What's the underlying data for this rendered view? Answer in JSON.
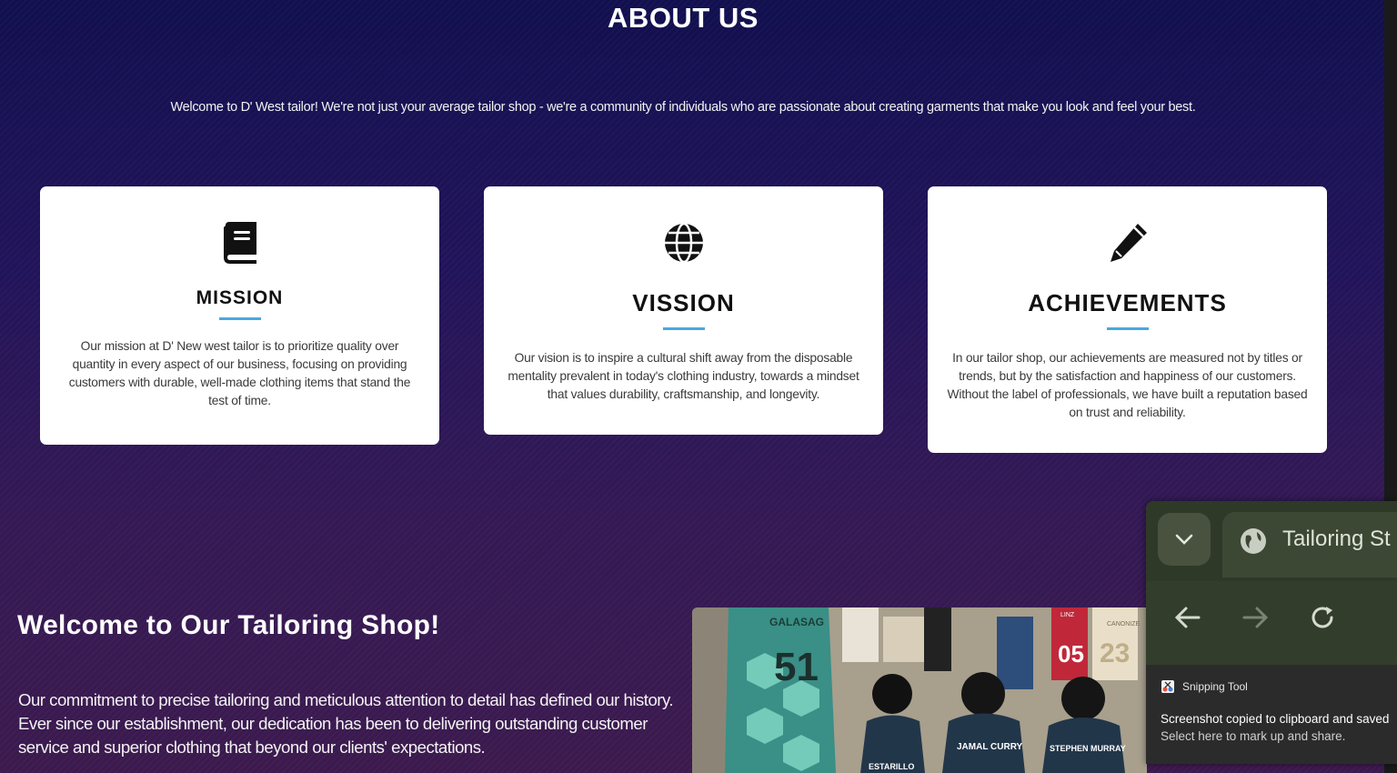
{
  "about": {
    "title": "ABOUT US",
    "intro": "Welcome to D' West tailor! We're not just your average tailor shop - we're a community of individuals who are passionate about creating garments that make you look and feel your best."
  },
  "cards": [
    {
      "icon": "book-icon",
      "title": "MISSION",
      "text": "Our mission at D' New west tailor is to prioritize quality over quantity in every aspect of our business, focusing on providing customers with durable, well-made clothing items that stand the test of time."
    },
    {
      "icon": "globe-icon",
      "title": "VISSION",
      "text": "Our vision is to inspire a cultural shift away from the disposable mentality prevalent in today's clothing industry, towards a mindset that values durability, craftsmanship, and longevity."
    },
    {
      "icon": "pencil-icon",
      "title": "ACHIEVEMENTS",
      "text": "In our tailor shop, our achievements are measured not by titles or trends, but by the satisfaction and happiness of our customers. Without the label of professionals, we have built a reputation based on trust and reliability."
    }
  ],
  "welcome": {
    "title": "Welcome to Our Tailoring Shop!",
    "body": "Our commitment to precise tailoring and meticulous attention to detail has defined our history. Ever since our establishment, our dedication has been to delivering outstanding customer service and superior clothing that beyond our clients' expectations."
  },
  "photo": {
    "jerseys": [
      "51",
      "05",
      "23"
    ],
    "jersey_names": [
      "GALASAG",
      "JAMAL CURRY",
      "STEPHEN MURRAY",
      "ESTARILLO",
      "LINZ",
      "CANONIZE"
    ]
  },
  "notification": {
    "tab_title": "Tailoring St",
    "app_name": "Snipping Tool",
    "message": "Screenshot copied to clipboard and saved",
    "sub": "Select here to mark up and share."
  },
  "colors": {
    "accent_rule": "#4aa8e0",
    "bg_top": "#12104f",
    "bg_bottom": "#3c1a4e"
  }
}
